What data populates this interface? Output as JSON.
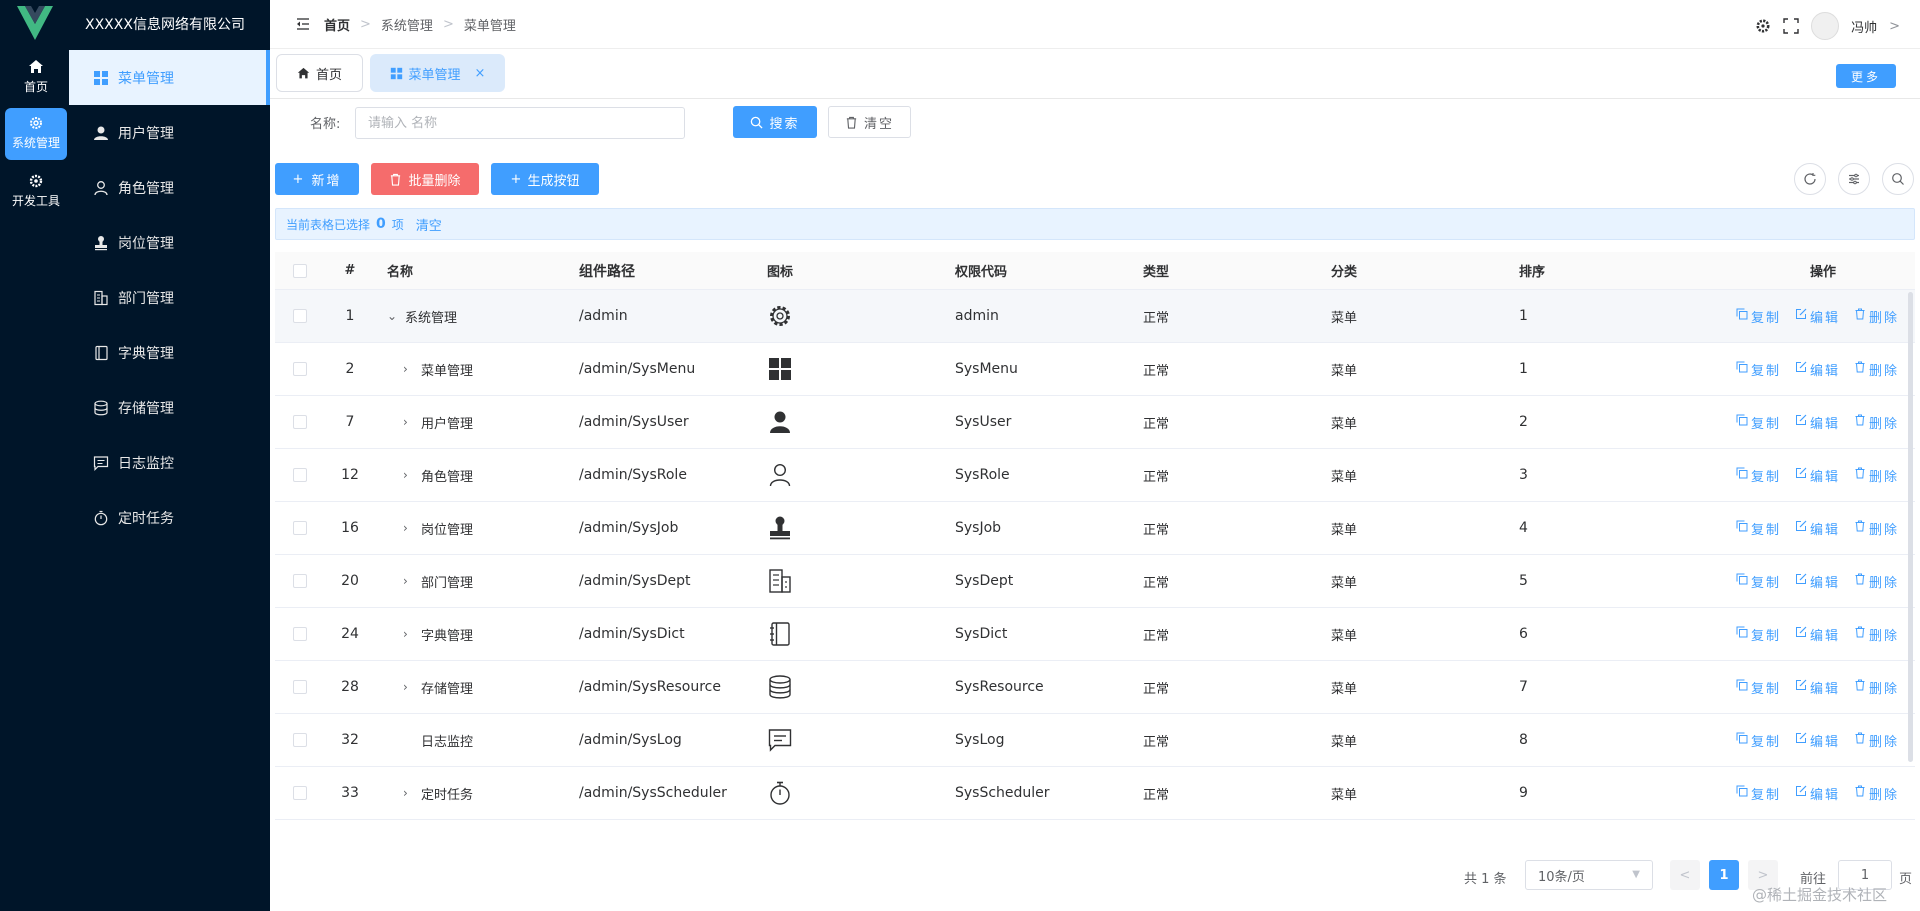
{
  "rail": {
    "items": [
      {
        "label": "首页",
        "icon": "home-icon"
      },
      {
        "label": "系统管理",
        "icon": "gear-icon"
      },
      {
        "label": "开发工具",
        "icon": "gear-icon"
      }
    ]
  },
  "sidebar": {
    "company": "XXXXX信息网络有限公司",
    "items": [
      {
        "label": "菜单管理"
      },
      {
        "label": "用户管理"
      },
      {
        "label": "角色管理"
      },
      {
        "label": "岗位管理"
      },
      {
        "label": "部门管理"
      },
      {
        "label": "字典管理"
      },
      {
        "label": "存储管理"
      },
      {
        "label": "日志监控"
      },
      {
        "label": "定时任务"
      }
    ]
  },
  "header": {
    "breadcrumb": [
      "首页",
      "系统管理",
      "菜单管理"
    ],
    "user": "冯帅"
  },
  "tabs": {
    "home": "首页",
    "menu": "菜单管理",
    "more": "更多"
  },
  "search": {
    "label": "名称:",
    "placeholder": "请输入 名称",
    "search_btn": "搜索",
    "clear_btn": "清空"
  },
  "toolbar": {
    "add": "新增",
    "batch_delete": "批量删除",
    "generate": "生成按钮"
  },
  "selection": {
    "prefix": "当前表格已选择",
    "count": "0",
    "suffix": "项",
    "clear": "清空"
  },
  "table": {
    "headers": {
      "idx": "#",
      "name": "名称",
      "path": "组件路径",
      "icon": "图标",
      "perm": "权限代码",
      "type": "类型",
      "cat": "分类",
      "sort": "排序",
      "ops": "操作"
    },
    "ops": {
      "copy": "复制",
      "edit": "编辑",
      "delete": "删除"
    },
    "rows": [
      {
        "idx": "1",
        "arrow": "down",
        "name": "系统管理",
        "path": "/admin",
        "icon": "gear-icon",
        "perm": "admin",
        "type": "正常",
        "cat": "菜单",
        "sort": "1"
      },
      {
        "idx": "2",
        "arrow": "right",
        "name": "菜单管理",
        "path": "/admin/SysMenu",
        "icon": "grid-icon",
        "perm": "SysMenu",
        "type": "正常",
        "cat": "菜单",
        "sort": "1"
      },
      {
        "idx": "7",
        "arrow": "right",
        "name": "用户管理",
        "path": "/admin/SysUser",
        "icon": "user-icon",
        "perm": "SysUser",
        "type": "正常",
        "cat": "菜单",
        "sort": "2"
      },
      {
        "idx": "12",
        "arrow": "right",
        "name": "角色管理",
        "path": "/admin/SysRole",
        "icon": "user-outline-icon",
        "perm": "SysRole",
        "type": "正常",
        "cat": "菜单",
        "sort": "3"
      },
      {
        "idx": "16",
        "arrow": "right",
        "name": "岗位管理",
        "path": "/admin/SysJob",
        "icon": "stamp-icon",
        "perm": "SysJob",
        "type": "正常",
        "cat": "菜单",
        "sort": "4"
      },
      {
        "idx": "20",
        "arrow": "right",
        "name": "部门管理",
        "path": "/admin/SysDept",
        "icon": "building-icon",
        "perm": "SysDept",
        "type": "正常",
        "cat": "菜单",
        "sort": "5"
      },
      {
        "idx": "24",
        "arrow": "right",
        "name": "字典管理",
        "path": "/admin/SysDict",
        "icon": "notebook-icon",
        "perm": "SysDict",
        "type": "正常",
        "cat": "菜单",
        "sort": "6"
      },
      {
        "idx": "28",
        "arrow": "right",
        "name": "存储管理",
        "path": "/admin/SysResource",
        "icon": "database-icon",
        "perm": "SysResource",
        "type": "正常",
        "cat": "菜单",
        "sort": "7"
      },
      {
        "idx": "32",
        "arrow": "none",
        "name": "日志监控",
        "path": "/admin/SysLog",
        "icon": "chat-icon",
        "perm": "SysLog",
        "type": "正常",
        "cat": "菜单",
        "sort": "8"
      },
      {
        "idx": "33",
        "arrow": "right",
        "name": "定时任务",
        "path": "/admin/SysScheduler",
        "icon": "stopwatch-icon",
        "perm": "SysScheduler",
        "type": "正常",
        "cat": "菜单",
        "sort": "9"
      }
    ]
  },
  "pagination": {
    "total": "共 1 条",
    "page_size": "10条/页",
    "current": "1",
    "goto_label": "前往",
    "goto_value": "1",
    "page_unit": "页"
  },
  "watermark": "@稀土掘金技术社区",
  "colors": {
    "primary": "#409eff",
    "danger": "#f56c6c",
    "sidebar": "#001529"
  }
}
